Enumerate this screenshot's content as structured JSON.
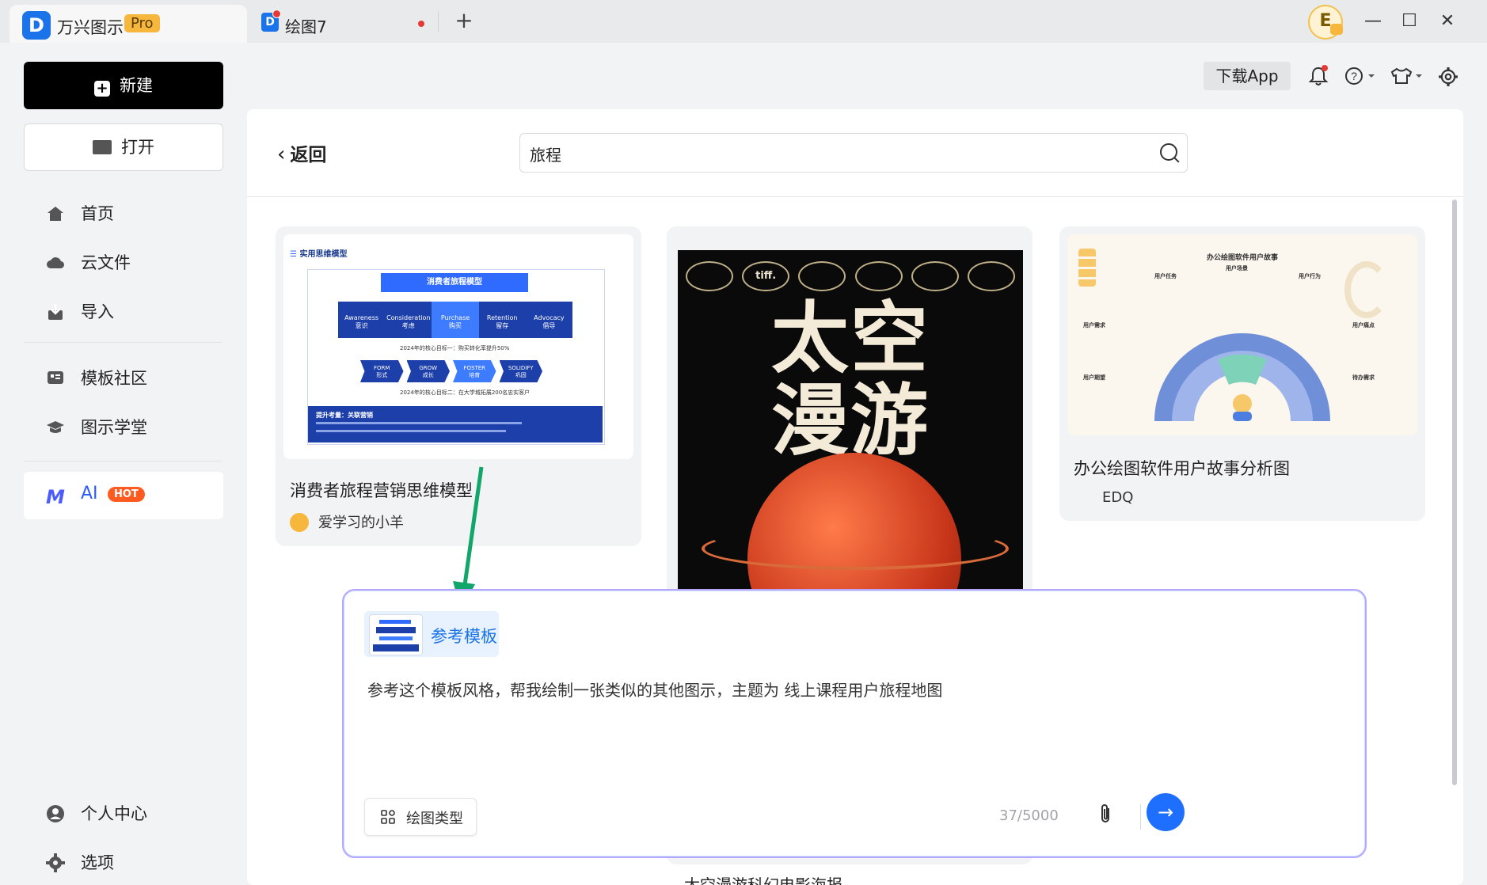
{
  "titlebar": {
    "app_name": "万兴图示",
    "badge": "Pro",
    "doc_tab": "绘图7",
    "add_tab": "+",
    "avatar_letter": "E",
    "minimize": "—",
    "maximize": "☐",
    "close": "✕"
  },
  "sidebar": {
    "new_label": "新建",
    "open_label": "打开",
    "items": [
      {
        "label": "首页"
      },
      {
        "label": "云文件"
      },
      {
        "label": "导入"
      },
      {
        "label": "模板社区"
      },
      {
        "label": "图示学堂"
      }
    ],
    "ai_label": "AI",
    "ai_badge": "HOT",
    "bottom_items": [
      {
        "label": "个人中心"
      },
      {
        "label": "选项"
      }
    ]
  },
  "toolbar": {
    "download_app": "下载App"
  },
  "search": {
    "back_label": "返回",
    "query": "旅程"
  },
  "cards": [
    {
      "title": "消费者旅程营销思维模型",
      "author": "爱学习的小羊",
      "thumb": {
        "header": "实用思维模型",
        "banner": "消费者旅程模型",
        "steps": [
          {
            "en": "Awareness",
            "cn": "意识"
          },
          {
            "en": "Consideration",
            "cn": "考虑"
          },
          {
            "en": "Purchase",
            "cn": "购买"
          },
          {
            "en": "Retention",
            "cn": "留存"
          },
          {
            "en": "Advocacy",
            "cn": "倡导"
          }
        ],
        "goal1": "2024年的核心目标一：购买转化率提升50%",
        "phases": [
          {
            "en": "FORM",
            "cn": "形式"
          },
          {
            "en": "GROW",
            "cn": "成长"
          },
          {
            "en": "FOSTER",
            "cn": "培育"
          },
          {
            "en": "SOLIDIFY",
            "cn": "巩固"
          }
        ],
        "goal2": "2024年的核心目标二：在大学城拓展200名忠实客户",
        "footer_title": "提升考量：关联营销"
      }
    },
    {
      "title": "太空漫游科幻电影海报",
      "poster_line1": "太空",
      "poster_line2": "漫游",
      "laurel_text": "tiff."
    },
    {
      "title": "办公绘图软件用户故事分析图",
      "author": "EDQ",
      "thumb": {
        "header": "办公绘图软件用户故事",
        "labels": [
          "用户任务",
          "用户场景",
          "用户行为",
          "用户需求",
          "用户痛点",
          "用户期望",
          "待办需求"
        ]
      }
    }
  ],
  "ai_dialog": {
    "ref_label": "参考模板",
    "prompt": "参考这个模板风格，帮我绘制一张类似的其他图示，主题为 线上课程用户旅程地图",
    "type_label": "绘图类型",
    "counter": "37/5000",
    "send": "→"
  },
  "colors": {
    "accent": "#1f6fff",
    "brand": "#1a73e8",
    "pro": "#f6b73c",
    "hot": "#ff5a1f",
    "arrow": "#13a66a"
  }
}
